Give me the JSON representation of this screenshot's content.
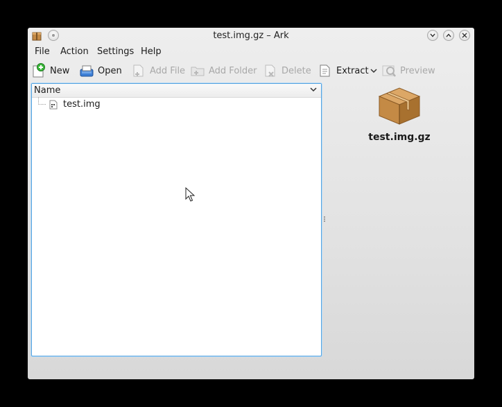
{
  "window": {
    "title": "test.img.gz – Ark"
  },
  "menubar": {
    "items": [
      {
        "label": "File"
      },
      {
        "label": "Action"
      },
      {
        "label": "Settings"
      },
      {
        "label": "Help"
      }
    ]
  },
  "toolbar": {
    "new_label": "New",
    "open_label": "Open",
    "add_file_label": "Add File",
    "add_folder_label": "Add Folder",
    "delete_label": "Delete",
    "extract_label": "Extract",
    "preview_label": "Preview"
  },
  "tree": {
    "column_header": "Name",
    "rows": [
      {
        "name": "test.img",
        "icon": "disk-image-file-icon"
      }
    ]
  },
  "preview_panel": {
    "archive_name": "test.img.gz",
    "icon": "archive-box-icon"
  },
  "colors": {
    "accent_border": "#56a4e0",
    "new_green": "#3cb93c",
    "open_blue": "#3d7fd6",
    "box_brown": "#c48a45"
  }
}
